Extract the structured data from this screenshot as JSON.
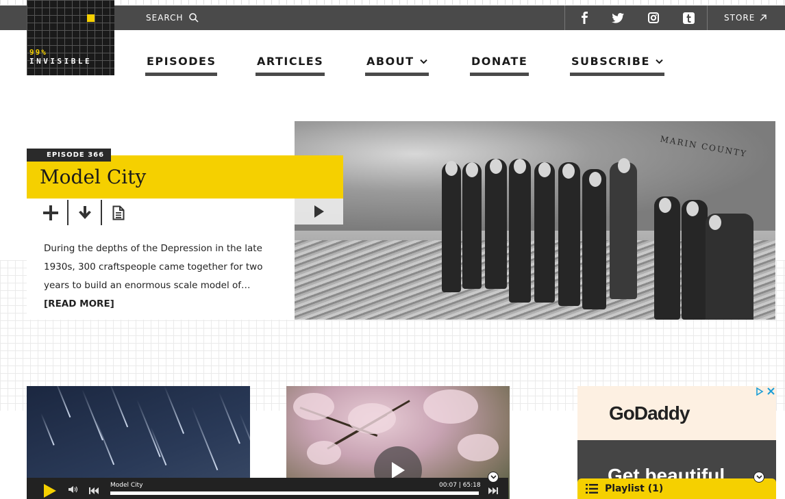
{
  "header": {
    "search_label": "SEARCH",
    "store_label": "STORE",
    "social": [
      "facebook-icon",
      "twitter-icon",
      "instagram-icon",
      "tumblr-icon"
    ]
  },
  "logo": {
    "line1": "99%",
    "line2": "INVISIBLE"
  },
  "nav": {
    "episodes": "EPISODES",
    "articles": "ARTICLES",
    "about": "ABOUT",
    "donate": "DONATE",
    "subscribe": "SUBSCRIBE"
  },
  "hero": {
    "episode_label": "EPISODE 366",
    "title": "Model City",
    "description": "During the depths of the Depression in the late 1930s, 300 craftspeople came together for two years to build an enormous scale model of…",
    "read_more": "[READ MORE]",
    "photo_sign": "MARIN COUNTY"
  },
  "ad": {
    "brand": "GoDaddy",
    "headline": "Get beautiful"
  },
  "player": {
    "track_title": "Model City",
    "time": "00:07 | 65:18"
  },
  "playlist": {
    "label": "Playlist (1)"
  },
  "colors": {
    "accent": "#f5d000",
    "bar": "#4a4a4a",
    "dark": "#222222"
  }
}
